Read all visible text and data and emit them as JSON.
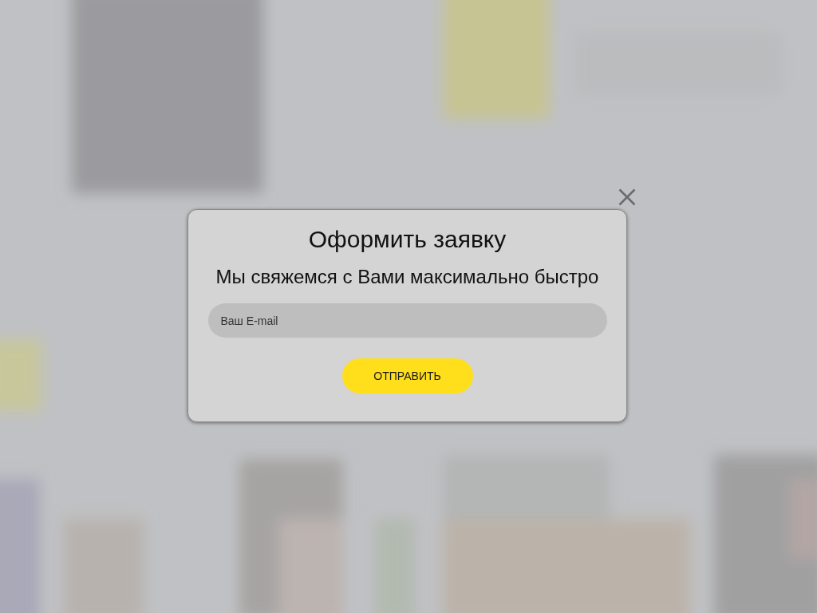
{
  "modal": {
    "title": "Оформить заявку",
    "subtitle": "Мы свяжемся с Вами максимально быстро",
    "email_field": {
      "placeholder": "Ваш E-mail"
    },
    "submit_button": {
      "label": "ОТПРАВИТЬ"
    }
  }
}
